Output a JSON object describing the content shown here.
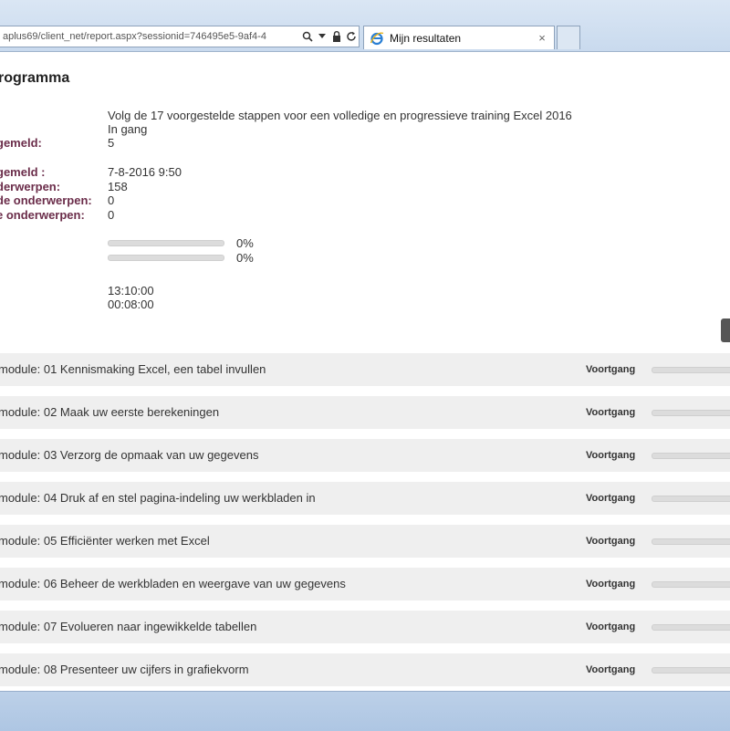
{
  "browser": {
    "address": "aplus69/client_net/report.aspx?sessionid=746495e5-9af4-4",
    "tab_title": "Mijn resultaten",
    "tab_close_glyph": "×",
    "favicon": "ie-icon"
  },
  "page": {
    "title": "rogramma"
  },
  "info": [
    {
      "label": "",
      "value": "Volg de 17 voorgestelde stappen voor een volledige en progressieve training Excel 2016"
    },
    {
      "label": "",
      "value": "In gang"
    },
    {
      "label": "gemeld:",
      "value": "5"
    },
    {
      "label": "gemeld :",
      "value": "7-8-2016 9:50"
    },
    {
      "label": "derwerpen:",
      "value": "158"
    },
    {
      "label": "de onderwerpen:",
      "value": "0"
    },
    {
      "label": "e onderwerpen:",
      "value": "0"
    }
  ],
  "progress": [
    {
      "percent_text": "0%",
      "value": 0
    },
    {
      "percent_text": "0%",
      "value": 0
    }
  ],
  "times": [
    {
      "label": ":",
      "value": "13:10:00"
    },
    {
      "label": "",
      "value": "00:08:00"
    }
  ],
  "modules": {
    "progress_label": "Voortgang",
    "items": [
      {
        "name": "module: 01 Kennismaking Excel, een tabel invullen",
        "progress": 0
      },
      {
        "name": "module: 02 Maak uw eerste berekeningen",
        "progress": 0
      },
      {
        "name": "module: 03 Verzorg de opmaak van uw gegevens",
        "progress": 0
      },
      {
        "name": "module: 04 Druk af en stel pagina-indeling uw werkbladen in",
        "progress": 0
      },
      {
        "name": "module: 05 Efficiënter werken met Excel",
        "progress": 0
      },
      {
        "name": "module: 06 Beheer de werkbladen en weergave van uw gegevens",
        "progress": 0
      },
      {
        "name": "module: 07 Evolueren naar ingewikkelde tabellen",
        "progress": 0
      },
      {
        "name": "module: 08 Presenteer uw cijfers in grafiekvorm",
        "progress": 0
      }
    ]
  }
}
